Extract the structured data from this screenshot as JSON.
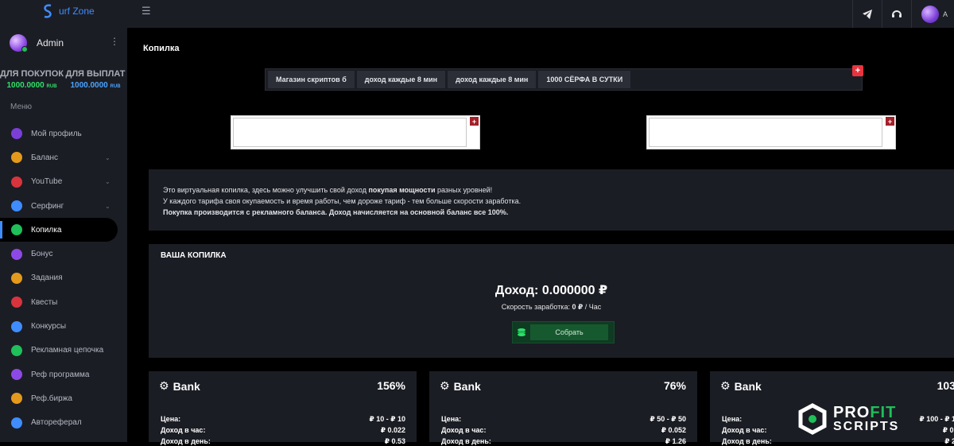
{
  "topbar": {
    "logo_text": "urf Zone",
    "user_initial": "A"
  },
  "sidebar": {
    "admin_name": "Admin",
    "balances": [
      {
        "label": "ДЛЯ ПОКУПОК",
        "value": "1000.0000",
        "unit": "RUB"
      },
      {
        "label": "ДЛЯ ВЫПЛАТ",
        "value": "1000.0000",
        "unit": "RUB"
      }
    ],
    "menu_title": "Меню",
    "items": [
      {
        "label": "Мой профиль",
        "icon": "gauge-icon",
        "color": "#7b3fd8",
        "chevron": false
      },
      {
        "label": "Баланс",
        "icon": "laptop-icon",
        "color": "#e39a1c",
        "chevron": true
      },
      {
        "label": "YouTube",
        "icon": "monitor-play-icon",
        "color": "#d8343e",
        "chevron": true
      },
      {
        "label": "Серфинг",
        "icon": "fingerprint-icon",
        "color": "#3f8cff",
        "chevron": true
      },
      {
        "label": "Копилка",
        "icon": "dollar-icon",
        "color": "#1fbf5a",
        "chevron": false,
        "active": true
      },
      {
        "label": "Бонус",
        "icon": "gift-icon",
        "color": "#8d49e6",
        "chevron": false
      },
      {
        "label": "Задания",
        "icon": "list-icon",
        "color": "#e39a1c",
        "chevron": false
      },
      {
        "label": "Квесты",
        "icon": "flag-icon",
        "color": "#d8343e",
        "chevron": false
      },
      {
        "label": "Конкурсы",
        "icon": "trophy-icon",
        "color": "#3f8cff",
        "chevron": false
      },
      {
        "label": "Рекламная цепочка",
        "icon": "bar-chart-icon",
        "color": "#1fbf5a",
        "chevron": false
      },
      {
        "label": "Реф программа",
        "icon": "users-icon",
        "color": "#8d49e6",
        "chevron": false
      },
      {
        "label": "Реф.биржа",
        "icon": "user-group-icon",
        "color": "#e39a1c",
        "chevron": false
      },
      {
        "label": "Автореферал",
        "icon": "user-icon",
        "color": "#3f8cff",
        "chevron": false
      }
    ]
  },
  "main": {
    "title": "Копилка",
    "ad_buttons": [
      "Магазин скриптов б",
      "доход каждые 8 мин",
      "доход каждые 8 мин",
      "1000 СЁРФА В СУТКИ"
    ],
    "ad_plus": "+",
    "info": {
      "line1_a": "Это виртуальная копилка, здесь можно улучшить свой доход ",
      "line1_b": "покупая мощности",
      "line1_c": " разных уровней!",
      "line2": "У каждого тарифа своя окупаемость и время работы, чем дороже тариф - тем больше скорости заработка.",
      "line3": "Покупка производится с рекламного баланса. Доход начисляется на основной баланс все 100%."
    },
    "kopilka": {
      "title": "ВАША КОПИЛКА",
      "income_label": "Доход:",
      "income_value": "0.000000 ₽",
      "speed_label": "Скорость заработка:",
      "speed_value": "0 ₽",
      "speed_unit": "/ Час",
      "collect_label": "Собрать"
    },
    "cards": [
      {
        "name": "Bank",
        "percent": "156%",
        "price": "₽ 10 - ₽ 10",
        "per_hour": "₽ 0.022",
        "per_day": "₽ 0.53"
      },
      {
        "name": "Bank",
        "percent": "76%",
        "price": "₽ 50 - ₽ 50",
        "per_hour": "₽ 0.052",
        "per_day": "₽ 1.26"
      },
      {
        "name": "Bank",
        "percent": "103",
        "price": "₽ 100 - ₽ 1",
        "per_hour": "₽ 0.",
        "per_day": "₽ 2"
      }
    ],
    "card_labels": {
      "price": "Цена:",
      "per_hour": "Доход в час:",
      "per_day": "Доход в день:"
    }
  },
  "watermark": {
    "line1_a": "PRO",
    "line1_b": "FIT",
    "line2": "SCRIPTS"
  }
}
